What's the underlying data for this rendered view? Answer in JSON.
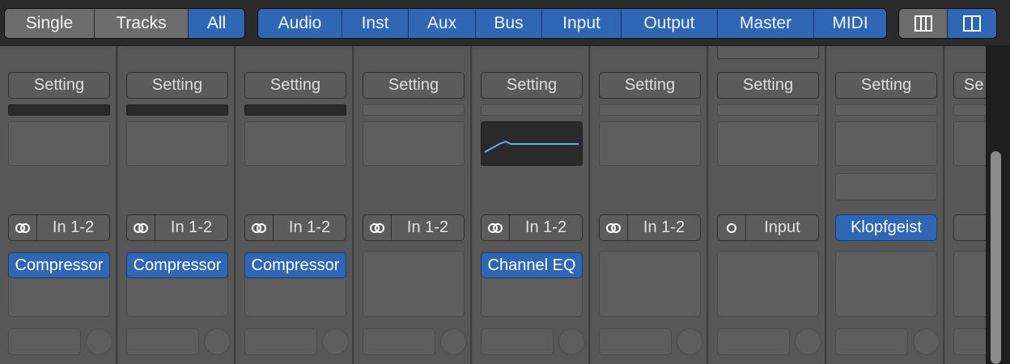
{
  "view_modes": [
    "Single",
    "Tracks",
    "All"
  ],
  "active_view": "All",
  "filters": [
    "Audio",
    "Inst",
    "Aux",
    "Bus",
    "Input",
    "Output",
    "Master",
    "MIDI"
  ],
  "layout_buttons": [
    {
      "icon": "narrow-columns-icon",
      "active": false
    },
    {
      "icon": "wide-columns-icon",
      "active": true
    }
  ],
  "colors": {
    "accent": "#2f67b5",
    "toolbar": "#2b2b2b",
    "strip": "#575757"
  },
  "strips": [
    {
      "setting": "Setting",
      "gain_dark": true,
      "eq_on": false,
      "input_icon": "stereo-link-icon",
      "input": "In 1-2",
      "plugin": "Compressor"
    },
    {
      "setting": "Setting",
      "gain_dark": true,
      "eq_on": false,
      "input_icon": "stereo-link-icon",
      "input": "In 1-2",
      "plugin": "Compressor"
    },
    {
      "setting": "Setting",
      "gain_dark": true,
      "eq_on": false,
      "input_icon": "stereo-link-icon",
      "input": "In 1-2",
      "plugin": "Compressor"
    },
    {
      "setting": "Setting",
      "gain_dark": false,
      "eq_on": false,
      "input_icon": "stereo-link-icon",
      "input": "In 1-2",
      "plugin": ""
    },
    {
      "setting": "Setting",
      "gain_dark": false,
      "eq_on": true,
      "input_icon": "stereo-link-icon",
      "input": "In 1-2",
      "plugin": "Channel EQ"
    },
    {
      "setting": "Setting",
      "gain_dark": false,
      "eq_on": false,
      "input_icon": "stereo-link-icon",
      "input": "In 1-2",
      "plugin": ""
    },
    {
      "setting": "Setting",
      "gain_dark": false,
      "eq_on": false,
      "input_icon": "mono-icon",
      "input": "Input",
      "plugin": "",
      "top_widget": true
    },
    {
      "setting": "Setting",
      "gain_dark": false,
      "eq_on": false,
      "instrument": "Klopfgeist",
      "plugin": "",
      "extra_slot": true
    },
    {
      "setting": "Se",
      "gain_dark": false,
      "eq_on": false,
      "partial": true
    }
  ]
}
